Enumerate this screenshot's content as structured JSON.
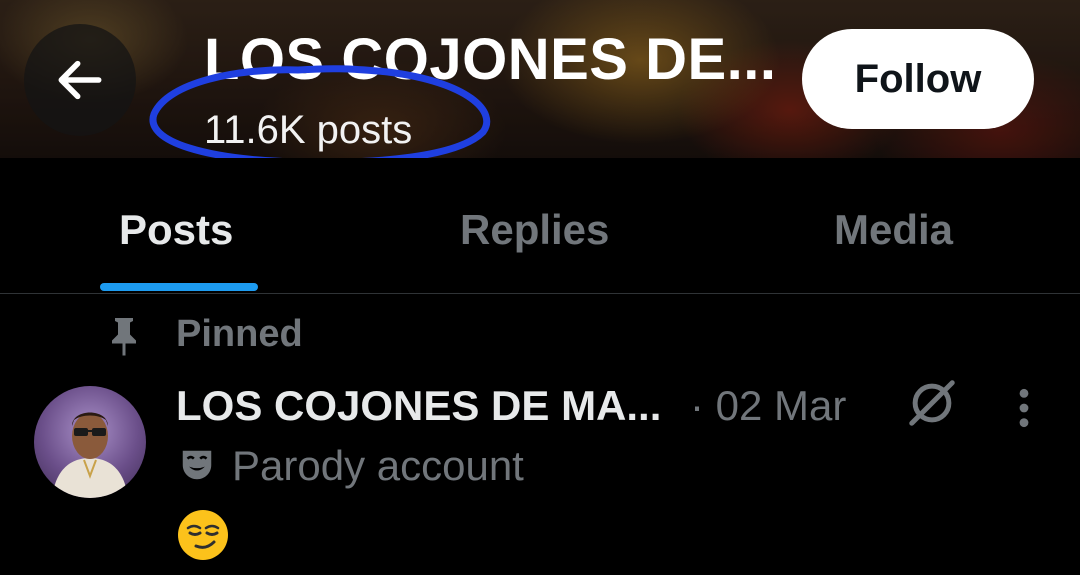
{
  "header": {
    "title": "LOS COJONES DE...",
    "post_count": "11.6K posts",
    "follow_label": "Follow",
    "back_icon": "arrow-left-icon",
    "annotation_color": "#1f3fe0"
  },
  "tabs": [
    {
      "label": "Posts",
      "active": true
    },
    {
      "label": "Replies",
      "active": false
    },
    {
      "label": "Media",
      "active": false
    }
  ],
  "accent_color": "#1d9bf0",
  "pinned_post": {
    "pinned_label": "Pinned",
    "author": "LOS COJONES DE MA...",
    "date": "· 02 Mar",
    "account_label": "Parody account",
    "content": "😏",
    "icons": [
      "pin-icon",
      "no-circle-icon",
      "more-vertical-icon",
      "theater-mask-icon"
    ]
  }
}
